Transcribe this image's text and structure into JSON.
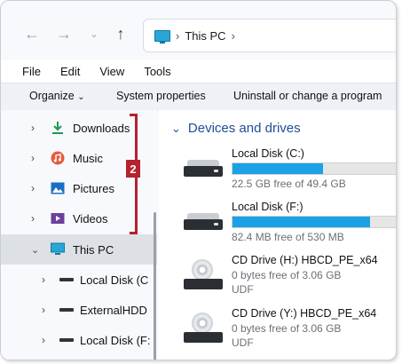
{
  "nav": {
    "back_icon": "back-arrow-icon",
    "forward_icon": "forward-arrow-icon",
    "recent_icon": "chevron-down-icon",
    "up_icon": "up-arrow-icon"
  },
  "address": {
    "icon": "this-pc-icon",
    "path": "This PC"
  },
  "menu": {
    "file": "File",
    "edit": "Edit",
    "view": "View",
    "tools": "Tools"
  },
  "commands": {
    "organize": "Organize",
    "system_properties": "System properties",
    "uninstall": "Uninstall or change a program"
  },
  "sidebar": {
    "items": [
      {
        "label": "Downloads",
        "icon": "download-icon"
      },
      {
        "label": "Music",
        "icon": "music-icon"
      },
      {
        "label": "Pictures",
        "icon": "pictures-icon"
      },
      {
        "label": "Videos",
        "icon": "videos-icon"
      },
      {
        "label": "This PC",
        "icon": "this-pc-icon",
        "selected": true
      },
      {
        "label": "Local Disk (C",
        "icon": "drive-icon"
      },
      {
        "label": "ExternalHDD",
        "icon": "drive-icon"
      },
      {
        "label": "Local Disk (F:",
        "icon": "drive-icon"
      }
    ],
    "badge": "2"
  },
  "main": {
    "section_title": "Devices and drives",
    "drives": [
      {
        "name": "Local Disk (C:)",
        "free": "22.5 GB free of 49.4 GB",
        "used_fraction": 0.55,
        "kind": "hdd"
      },
      {
        "name": "Local Disk (F:)",
        "free": "82.4 MB free of 530 MB",
        "used_fraction": 0.84,
        "kind": "hdd"
      },
      {
        "name": "CD Drive (H:) HBCD_PE_x64",
        "free": "0 bytes free of 3.06 GB",
        "fs": "UDF",
        "kind": "cd"
      },
      {
        "name": "CD Drive (Y:) HBCD_PE_x64",
        "free": "0 bytes free of 3.06 GB",
        "fs": "UDF",
        "kind": "cd"
      }
    ]
  },
  "colors": {
    "accent": "#1aa1e6",
    "annotation": "#b5222e",
    "section_title": "#1f4e97"
  }
}
